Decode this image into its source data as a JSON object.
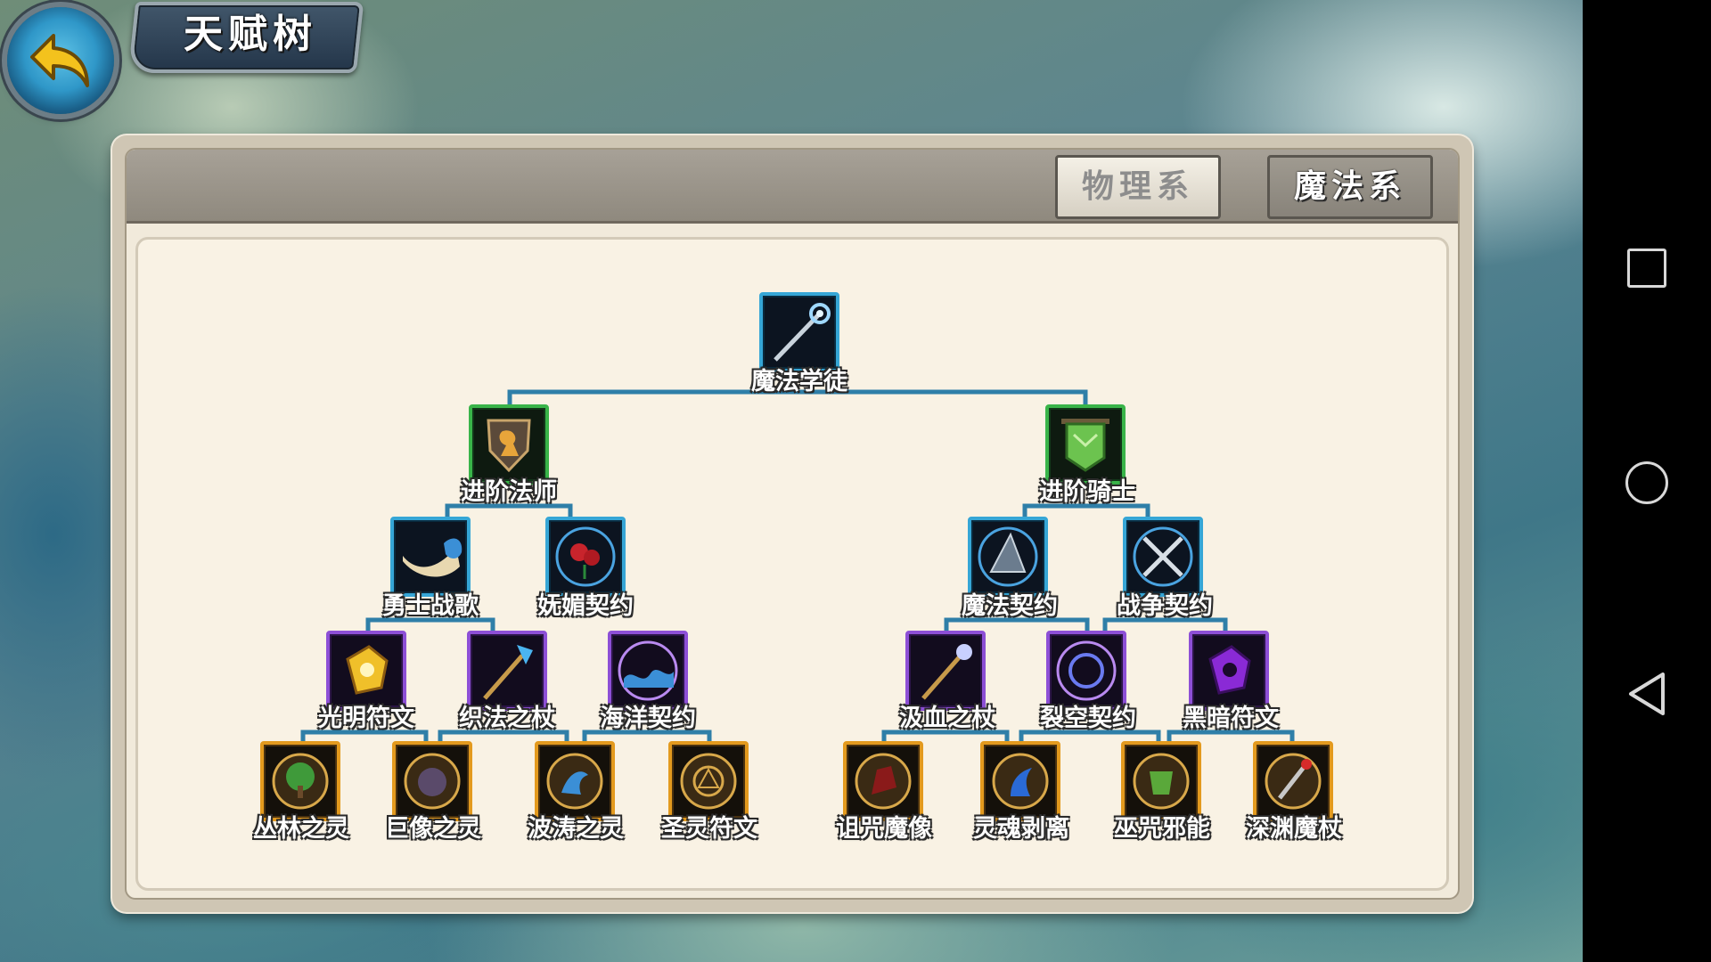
{
  "header": {
    "title": "天赋树"
  },
  "tabs": [
    {
      "label": "物理系",
      "active": false
    },
    {
      "label": "魔法系",
      "active": true
    }
  ],
  "tree": {
    "root": {
      "label": "魔法学徒",
      "icon": "staff-icon"
    },
    "tier2": [
      {
        "label": "进阶法师",
        "icon": "knight-shield-icon"
      },
      {
        "label": "进阶骑士",
        "icon": "green-banner-icon"
      }
    ],
    "tier3": [
      {
        "label": "勇士战歌",
        "icon": "war-horn-icon"
      },
      {
        "label": "妩媚契约",
        "icon": "rose-sigil-icon"
      },
      {
        "label": "魔法契约",
        "icon": "wizard-hat-sigil-icon"
      },
      {
        "label": "战争契约",
        "icon": "crossed-swords-sigil-icon"
      }
    ],
    "tier4": [
      {
        "label": "光明符文",
        "icon": "light-rune-icon"
      },
      {
        "label": "织法之杖",
        "icon": "weave-staff-icon"
      },
      {
        "label": "海洋契约",
        "icon": "wave-sigil-icon"
      },
      {
        "label": "汲血之杖",
        "icon": "blood-staff-icon"
      },
      {
        "label": "裂空契约",
        "icon": "rift-sigil-icon"
      },
      {
        "label": "黑暗符文",
        "icon": "dark-rune-icon"
      }
    ],
    "tier5": [
      {
        "label": "丛林之灵",
        "icon": "forest-spirit-icon"
      },
      {
        "label": "巨像之灵",
        "icon": "colossus-spirit-icon"
      },
      {
        "label": "波涛之灵",
        "icon": "tide-spirit-icon"
      },
      {
        "label": "圣灵符文",
        "icon": "holy-rune-icon"
      },
      {
        "label": "诅咒魔像",
        "icon": "cursed-golem-icon"
      },
      {
        "label": "灵魂剥离",
        "icon": "soul-strip-icon"
      },
      {
        "label": "巫咒邪能",
        "icon": "hex-energy-icon"
      },
      {
        "label": "深渊魔杖",
        "icon": "abyss-wand-icon"
      }
    ]
  },
  "colors": {
    "connector": "#2f7fa8",
    "tier2_frame": "#39b449",
    "tier3_frame": "#36a6d6",
    "tier4_frame": "#8d4fd6",
    "tier5_frame": "#e39a1e"
  },
  "nav": {
    "buttons": [
      "recents-square-icon",
      "home-circle-icon",
      "back-triangle-icon"
    ]
  }
}
